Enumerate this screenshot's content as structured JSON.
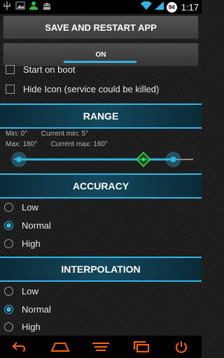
{
  "status_bar": {
    "time": "1:17",
    "battery": "94",
    "left_icons": [
      "usb-icon",
      "image-icon",
      "person-icon",
      "android-icon"
    ]
  },
  "buttons": {
    "save_label": "SAVE AND RESTART APP",
    "toggle_label": "ON"
  },
  "options": {
    "start_on_boot": {
      "label": "Start on boot",
      "checked": false
    },
    "hide_icon": {
      "label": "Hide Icon (service could be killed)",
      "checked": false
    }
  },
  "range": {
    "title": "RANGE",
    "min_label": "Min: 0°",
    "current_min_label": "Current min: 5°",
    "max_label": "Max: 180°",
    "current_max_label": "Current max: 160°",
    "min": 0,
    "max": 180,
    "current_min": 5,
    "current_max": 160,
    "position": 130
  },
  "accuracy": {
    "title": "ACCURACY",
    "options": [
      "Low",
      "Normal",
      "High"
    ],
    "selected": "Normal"
  },
  "interpolation": {
    "title": "INTERPOLATION",
    "options": [
      "Low",
      "Normal",
      "High"
    ],
    "selected": "Normal"
  },
  "colors": {
    "accent": "#33b5e5",
    "marker": "#3be33b",
    "power": "#ff6600"
  },
  "nav_icons": [
    "back-icon",
    "home-icon",
    "menu-icon",
    "recent-apps-icon",
    "power-icon"
  ]
}
